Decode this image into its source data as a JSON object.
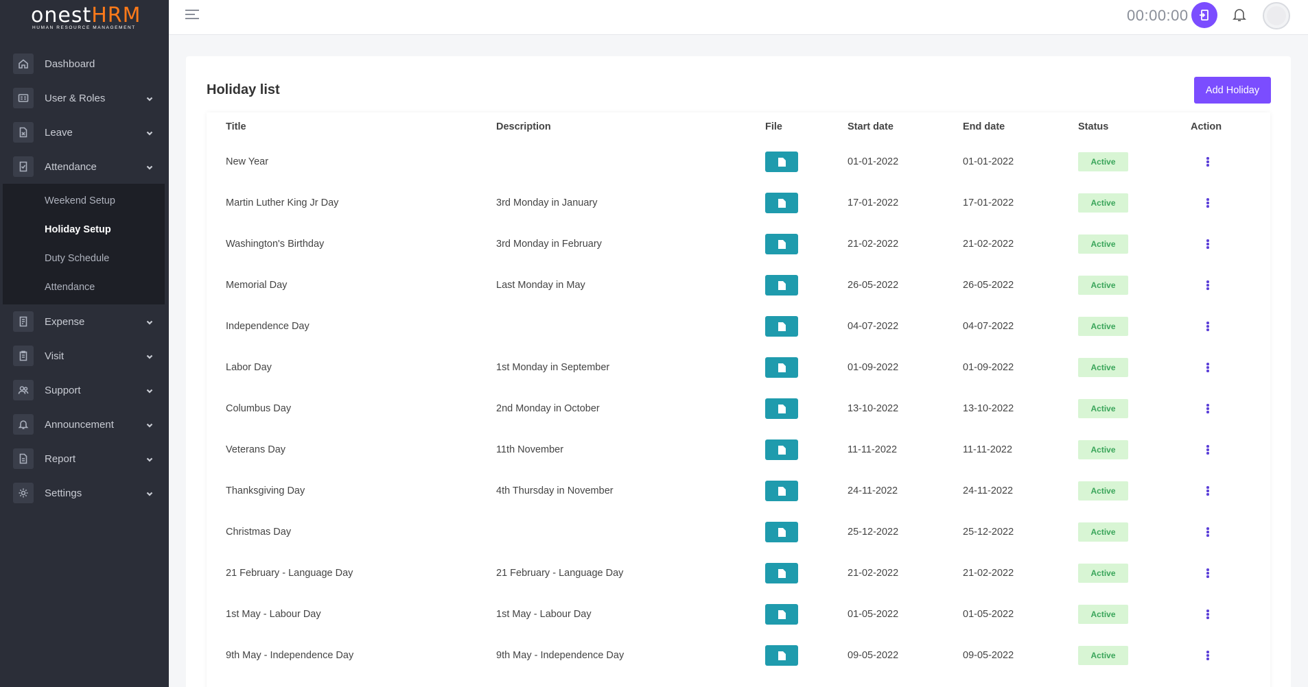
{
  "brand": {
    "name_a": "onest",
    "name_b": "HRM",
    "tagline": "HUMAN RESOURCE MANAGEMENT",
    "accent": "#ff7a1a"
  },
  "sidebar": {
    "items": [
      {
        "label": "Dashboard",
        "icon": "home-icon"
      },
      {
        "label": "User & Roles",
        "icon": "id-card-icon"
      },
      {
        "label": "Leave",
        "icon": "document-x-icon"
      },
      {
        "label": "Attendance",
        "icon": "checklist-icon"
      },
      {
        "label": "Expense",
        "icon": "receipt-icon"
      },
      {
        "label": "Visit",
        "icon": "clipboard-icon"
      },
      {
        "label": "Support",
        "icon": "users-icon"
      },
      {
        "label": "Announcement",
        "icon": "bell-icon"
      },
      {
        "label": "Report",
        "icon": "report-icon"
      },
      {
        "label": "Settings",
        "icon": "gear-icon"
      }
    ],
    "attendance_sub": [
      {
        "label": "Weekend Setup"
      },
      {
        "label": "Holiday Setup"
      },
      {
        "label": "Duty Schedule"
      },
      {
        "label": "Attendance"
      }
    ]
  },
  "topbar": {
    "timer": "00:00:00",
    "clock_icon": "check-in-icon",
    "bell_icon": "bell-icon"
  },
  "page": {
    "title": "Holiday list",
    "add_button": "Add Holiday",
    "accent": "#7b4dff"
  },
  "table": {
    "headers": [
      "Title",
      "Description",
      "File",
      "Start date",
      "End date",
      "Status",
      "Action"
    ],
    "rows": [
      {
        "title": "New Year",
        "description": "",
        "start": "01-01-2022",
        "end": "01-01-2022",
        "status": "Active"
      },
      {
        "title": "Martin Luther King Jr Day",
        "description": "3rd Monday in January",
        "start": "17-01-2022",
        "end": "17-01-2022",
        "status": "Active"
      },
      {
        "title": "Washington's Birthday",
        "description": "3rd Monday in February",
        "start": "21-02-2022",
        "end": "21-02-2022",
        "status": "Active"
      },
      {
        "title": "Memorial Day",
        "description": "Last Monday in May",
        "start": "26-05-2022",
        "end": "26-05-2022",
        "status": "Active"
      },
      {
        "title": "Independence Day",
        "description": "",
        "start": "04-07-2022",
        "end": "04-07-2022",
        "status": "Active"
      },
      {
        "title": "Labor Day",
        "description": "1st Monday in September",
        "start": "01-09-2022",
        "end": "01-09-2022",
        "status": "Active"
      },
      {
        "title": "Columbus Day",
        "description": "2nd Monday in October",
        "start": "13-10-2022",
        "end": "13-10-2022",
        "status": "Active"
      },
      {
        "title": "Veterans Day",
        "description": "11th November",
        "start": "11-11-2022",
        "end": "11-11-2022",
        "status": "Active"
      },
      {
        "title": "Thanksgiving Day",
        "description": "4th Thursday in November",
        "start": "24-11-2022",
        "end": "24-11-2022",
        "status": "Active"
      },
      {
        "title": "Christmas Day",
        "description": "",
        "start": "25-12-2022",
        "end": "25-12-2022",
        "status": "Active"
      },
      {
        "title": "21 February - Language Day",
        "description": "21 February - Language Day",
        "start": "21-02-2022",
        "end": "21-02-2022",
        "status": "Active"
      },
      {
        "title": "1st May - Labour Day",
        "description": "1st May - Labour Day",
        "start": "01-05-2022",
        "end": "01-05-2022",
        "status": "Active"
      },
      {
        "title": "9th May - Independence Day",
        "description": "9th May - Independence Day",
        "start": "09-05-2022",
        "end": "09-05-2022",
        "status": "Active"
      }
    ]
  }
}
